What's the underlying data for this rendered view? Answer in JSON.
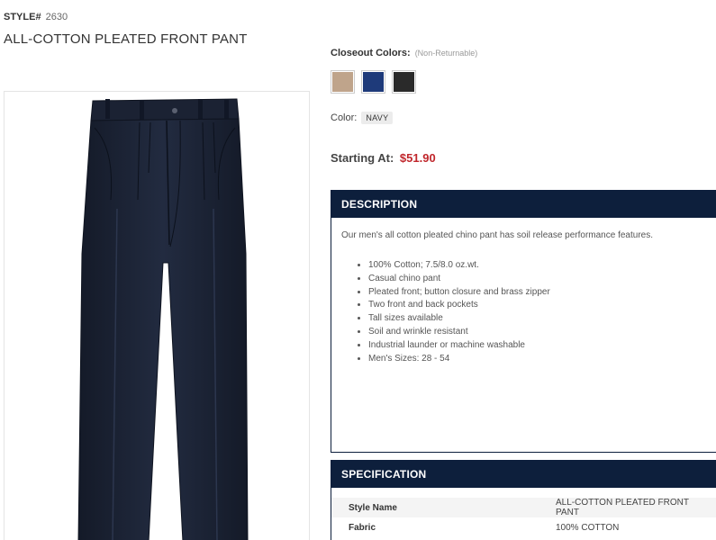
{
  "product": {
    "style_label": "STYLE#",
    "style_number": "2630",
    "title": "ALL-COTTON PLEATED FRONT PANT",
    "image_alt": "Navy pleated front pant"
  },
  "closeout": {
    "label": "Closeout Colors:",
    "note": "(Non-Returnable)",
    "swatches": [
      {
        "name": "khaki",
        "color": "#bfa48b"
      },
      {
        "name": "navy",
        "color": "#1e3a7a"
      },
      {
        "name": "black",
        "color": "#2a2a2a"
      }
    ]
  },
  "color": {
    "label": "Color:",
    "selected": "NAVY"
  },
  "price": {
    "label": "Starting At:",
    "value": "$51.90"
  },
  "description": {
    "heading": "DESCRIPTION",
    "intro": "Our men's all cotton pleated chino pant has soil release performance features.",
    "bullets": [
      "100% Cotton; 7.5/8.0 oz.wt.",
      "Casual chino pant",
      "Pleated front; button closure and brass zipper",
      "Two front and back pockets",
      "Tall sizes available",
      "Soil and wrinkle resistant",
      "Industrial launder or machine washable",
      "Men's Sizes: 28 - 54"
    ]
  },
  "specification": {
    "heading": "SPECIFICATION",
    "rows": [
      {
        "key": "Style Name",
        "value": "ALL-COTTON PLEATED FRONT PANT"
      },
      {
        "key": "Fabric",
        "value": "100% COTTON"
      }
    ]
  },
  "colors": {
    "panel_header": "#0d1f3c",
    "price": "#c0262b",
    "pant": "#1b2233"
  }
}
